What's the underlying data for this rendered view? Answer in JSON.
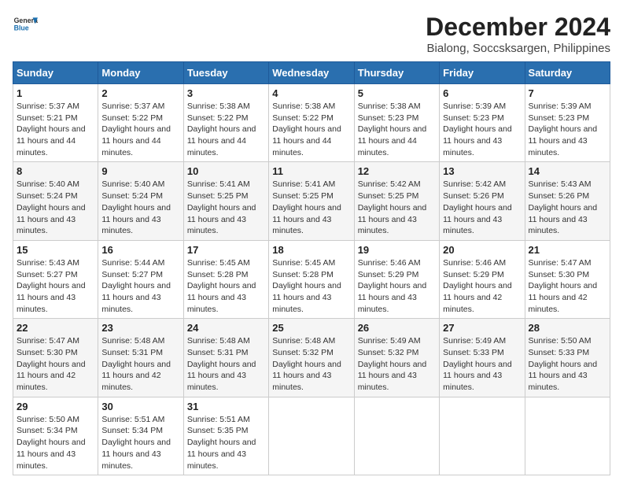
{
  "header": {
    "logo": {
      "line1": "General",
      "line2": "Blue"
    },
    "title": "December 2024",
    "subtitle": "Bialong, Soccsksargen, Philippines"
  },
  "calendar": {
    "columns": [
      "Sunday",
      "Monday",
      "Tuesday",
      "Wednesday",
      "Thursday",
      "Friday",
      "Saturday"
    ],
    "weeks": [
      [
        {
          "day": "",
          "sunrise": "",
          "sunset": "",
          "daylight": ""
        },
        {
          "day": "2",
          "sunrise": "5:37 AM",
          "sunset": "5:22 PM",
          "daylight": "11 hours and 44 minutes."
        },
        {
          "day": "3",
          "sunrise": "5:38 AM",
          "sunset": "5:22 PM",
          "daylight": "11 hours and 44 minutes."
        },
        {
          "day": "4",
          "sunrise": "5:38 AM",
          "sunset": "5:22 PM",
          "daylight": "11 hours and 44 minutes."
        },
        {
          "day": "5",
          "sunrise": "5:38 AM",
          "sunset": "5:23 PM",
          "daylight": "11 hours and 44 minutes."
        },
        {
          "day": "6",
          "sunrise": "5:39 AM",
          "sunset": "5:23 PM",
          "daylight": "11 hours and 43 minutes."
        },
        {
          "day": "7",
          "sunrise": "5:39 AM",
          "sunset": "5:23 PM",
          "daylight": "11 hours and 43 minutes."
        }
      ],
      [
        {
          "day": "8",
          "sunrise": "5:40 AM",
          "sunset": "5:24 PM",
          "daylight": "11 hours and 43 minutes."
        },
        {
          "day": "9",
          "sunrise": "5:40 AM",
          "sunset": "5:24 PM",
          "daylight": "11 hours and 43 minutes."
        },
        {
          "day": "10",
          "sunrise": "5:41 AM",
          "sunset": "5:25 PM",
          "daylight": "11 hours and 43 minutes."
        },
        {
          "day": "11",
          "sunrise": "5:41 AM",
          "sunset": "5:25 PM",
          "daylight": "11 hours and 43 minutes."
        },
        {
          "day": "12",
          "sunrise": "5:42 AM",
          "sunset": "5:25 PM",
          "daylight": "11 hours and 43 minutes."
        },
        {
          "day": "13",
          "sunrise": "5:42 AM",
          "sunset": "5:26 PM",
          "daylight": "11 hours and 43 minutes."
        },
        {
          "day": "14",
          "sunrise": "5:43 AM",
          "sunset": "5:26 PM",
          "daylight": "11 hours and 43 minutes."
        }
      ],
      [
        {
          "day": "15",
          "sunrise": "5:43 AM",
          "sunset": "5:27 PM",
          "daylight": "11 hours and 43 minutes."
        },
        {
          "day": "16",
          "sunrise": "5:44 AM",
          "sunset": "5:27 PM",
          "daylight": "11 hours and 43 minutes."
        },
        {
          "day": "17",
          "sunrise": "5:45 AM",
          "sunset": "5:28 PM",
          "daylight": "11 hours and 43 minutes."
        },
        {
          "day": "18",
          "sunrise": "5:45 AM",
          "sunset": "5:28 PM",
          "daylight": "11 hours and 43 minutes."
        },
        {
          "day": "19",
          "sunrise": "5:46 AM",
          "sunset": "5:29 PM",
          "daylight": "11 hours and 43 minutes."
        },
        {
          "day": "20",
          "sunrise": "5:46 AM",
          "sunset": "5:29 PM",
          "daylight": "11 hours and 42 minutes."
        },
        {
          "day": "21",
          "sunrise": "5:47 AM",
          "sunset": "5:30 PM",
          "daylight": "11 hours and 42 minutes."
        }
      ],
      [
        {
          "day": "22",
          "sunrise": "5:47 AM",
          "sunset": "5:30 PM",
          "daylight": "11 hours and 42 minutes."
        },
        {
          "day": "23",
          "sunrise": "5:48 AM",
          "sunset": "5:31 PM",
          "daylight": "11 hours and 42 minutes."
        },
        {
          "day": "24",
          "sunrise": "5:48 AM",
          "sunset": "5:31 PM",
          "daylight": "11 hours and 43 minutes."
        },
        {
          "day": "25",
          "sunrise": "5:48 AM",
          "sunset": "5:32 PM",
          "daylight": "11 hours and 43 minutes."
        },
        {
          "day": "26",
          "sunrise": "5:49 AM",
          "sunset": "5:32 PM",
          "daylight": "11 hours and 43 minutes."
        },
        {
          "day": "27",
          "sunrise": "5:49 AM",
          "sunset": "5:33 PM",
          "daylight": "11 hours and 43 minutes."
        },
        {
          "day": "28",
          "sunrise": "5:50 AM",
          "sunset": "5:33 PM",
          "daylight": "11 hours and 43 minutes."
        }
      ],
      [
        {
          "day": "29",
          "sunrise": "5:50 AM",
          "sunset": "5:34 PM",
          "daylight": "11 hours and 43 minutes."
        },
        {
          "day": "30",
          "sunrise": "5:51 AM",
          "sunset": "5:34 PM",
          "daylight": "11 hours and 43 minutes."
        },
        {
          "day": "31",
          "sunrise": "5:51 AM",
          "sunset": "5:35 PM",
          "daylight": "11 hours and 43 minutes."
        },
        {
          "day": "",
          "sunrise": "",
          "sunset": "",
          "daylight": ""
        },
        {
          "day": "",
          "sunrise": "",
          "sunset": "",
          "daylight": ""
        },
        {
          "day": "",
          "sunrise": "",
          "sunset": "",
          "daylight": ""
        },
        {
          "day": "",
          "sunrise": "",
          "sunset": "",
          "daylight": ""
        }
      ]
    ],
    "week1_sunday": {
      "day": "1",
      "sunrise": "5:37 AM",
      "sunset": "5:21 PM",
      "daylight": "11 hours and 44 minutes."
    }
  }
}
